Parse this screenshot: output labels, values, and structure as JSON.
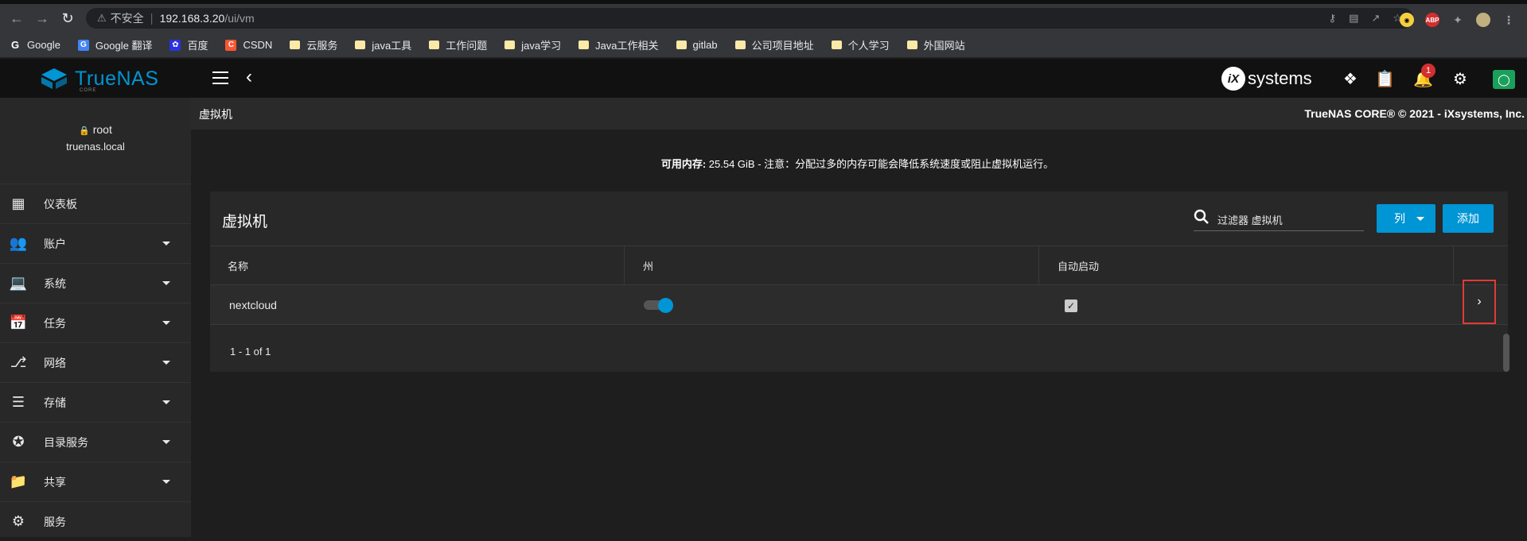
{
  "browser": {
    "insecure_label": "不安全",
    "url_host": "192.168.3.20",
    "url_path": "/ui/vm",
    "ext_abp": "ABP",
    "bookmarks": [
      {
        "label": "Google",
        "icon": "google-icon"
      },
      {
        "label": "Google 翻译",
        "icon": "translate-icon"
      },
      {
        "label": "百度",
        "icon": "baidu-icon"
      },
      {
        "label": "CSDN",
        "icon": "csdn-icon"
      },
      {
        "label": "云服务",
        "icon": "folder-icon"
      },
      {
        "label": "java工具",
        "icon": "folder-icon"
      },
      {
        "label": "工作问题",
        "icon": "folder-icon"
      },
      {
        "label": "java学习",
        "icon": "folder-icon"
      },
      {
        "label": "Java工作相关",
        "icon": "folder-icon"
      },
      {
        "label": "gitlab",
        "icon": "folder-icon"
      },
      {
        "label": "公司项目地址",
        "icon": "folder-icon"
      },
      {
        "label": "个人学习",
        "icon": "folder-icon"
      },
      {
        "label": "外国网站",
        "icon": "folder-icon"
      }
    ]
  },
  "topbar": {
    "logo_name": "TrueNAS",
    "logo_sub": "CORE",
    "ix_logo_mark": "iX",
    "ix_logo_text": "systems",
    "notification_count": "1",
    "accent": "#0095d5"
  },
  "sidebar": {
    "user": "root",
    "hostname": "truenas.local",
    "items": [
      {
        "label": "仪表板",
        "icon": "dashboard-icon",
        "expandable": false
      },
      {
        "label": "账户",
        "icon": "accounts-icon",
        "expandable": true
      },
      {
        "label": "系统",
        "icon": "system-icon",
        "expandable": true
      },
      {
        "label": "任务",
        "icon": "tasks-icon",
        "expandable": true
      },
      {
        "label": "网络",
        "icon": "network-icon",
        "expandable": true
      },
      {
        "label": "存储",
        "icon": "storage-icon",
        "expandable": true
      },
      {
        "label": "目录服务",
        "icon": "directory-services-icon",
        "expandable": true
      },
      {
        "label": "共享",
        "icon": "sharing-icon",
        "expandable": true
      },
      {
        "label": "服务",
        "icon": "services-icon",
        "expandable": false
      }
    ]
  },
  "page": {
    "title": "虚拟机",
    "copyright": "TrueNAS CORE® © 2021 - iXsystems, Inc.",
    "memory_label": "可用内存:",
    "memory_value": " 25.54 GiB - 注意：分配过多的内存可能会降低系统速度或阻止虚拟机运行。"
  },
  "card": {
    "title": "虚拟机",
    "filter_placeholder": "过滤器 虚拟机",
    "columns_button": "列",
    "add_button": "添加",
    "headers": [
      "名称",
      "州",
      "自动启动"
    ],
    "rows": [
      {
        "name": "nextcloud",
        "state_on": true,
        "autostart": true
      }
    ],
    "paginator": "1 - 1 of 1"
  }
}
